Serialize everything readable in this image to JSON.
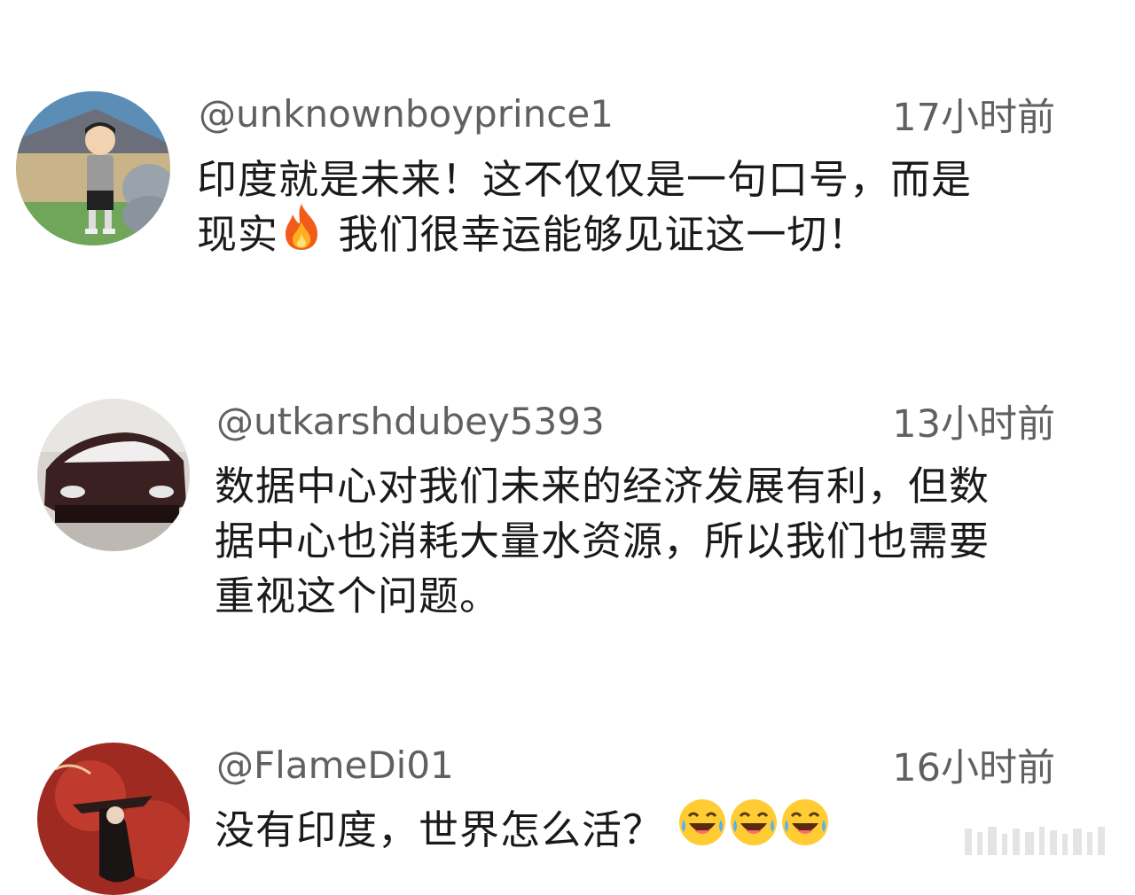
{
  "comments": [
    {
      "username": "@unknownboyprince1",
      "time": "17小时前",
      "text_line1": "印度就是未来！这不仅仅是一句口号，而是",
      "text_line2_before": "现实",
      "text_line2_emoji": "fire-icon",
      "text_line2_after": " 我们很幸运能够见证这一切！",
      "avatar": "cartoon-boy-avatar"
    },
    {
      "username": "@utkarshdubey5393",
      "time": "13小时前",
      "text_line1": "数据中心对我们未来的经济发展有利，但数",
      "text_line2": "据中心也消耗大量水资源，所以我们也需要",
      "text_line3": "重视这个问题。",
      "avatar": "car-avatar"
    },
    {
      "username": "@FlameDi01",
      "time": "16小时前",
      "text": "没有印度，世界怎么活？",
      "emojis": [
        "laughing-crying-icon",
        "laughing-crying-icon",
        "laughing-crying-icon"
      ],
      "avatar": "dark-figure-avatar"
    }
  ],
  "colors": {
    "username": "#606060",
    "body_text": "#1a1a1a",
    "background": "#ffffff"
  }
}
